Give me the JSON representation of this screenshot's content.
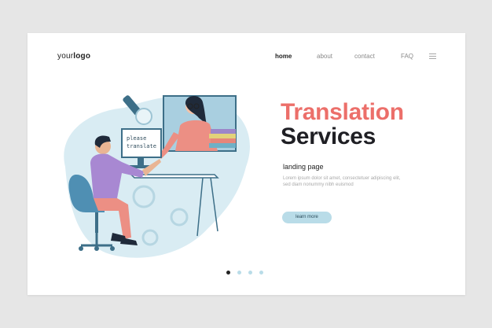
{
  "header": {
    "logo_regular": "your",
    "logo_bold": "logo",
    "nav": [
      "home",
      "about",
      "contact",
      "FAQ"
    ],
    "menu_icon": "hamburger-menu-icon"
  },
  "illustration": {
    "speech_text_line1": "please",
    "speech_text_line2": "translate"
  },
  "hero": {
    "title_line1": "Translation",
    "title_line2": "Services",
    "subtitle": "landing page",
    "body": "Lorem ipsum dolor sit amet, consectetuer adipiscing elit, sed diam nonummy nibh euismod",
    "button_label": "learn more"
  },
  "pagination": {
    "count": 4,
    "active_index": 0
  },
  "colors": {
    "accent_coral": "#ec6f6a",
    "accent_blue": "#b9dce8",
    "dark": "#1f1f24"
  }
}
